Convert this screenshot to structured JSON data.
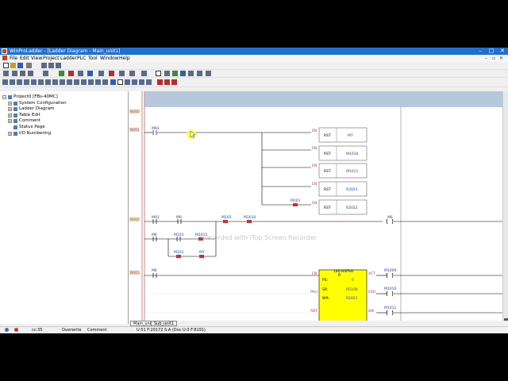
{
  "window": {
    "title": "WinProLadder - [Ladder Diagram - Main_unit1]"
  },
  "menu": [
    "File",
    "Edit",
    "View",
    "Project",
    "Ladder",
    "PLC",
    "Tool",
    "Window",
    "Help"
  ],
  "tree": [
    {
      "label": "Project0 [FBs-40MC]",
      "depth": 0,
      "expander": "−"
    },
    {
      "label": "System Configuration",
      "depth": 1,
      "expander": "+"
    },
    {
      "label": "Ladder Diagram",
      "depth": 1,
      "expander": "+"
    },
    {
      "label": "Table Edit",
      "depth": 1,
      "expander": "+"
    },
    {
      "label": "Comment",
      "depth": 1,
      "expander": "+"
    },
    {
      "label": "Status Page",
      "depth": 1,
      "expander": ""
    },
    {
      "label": "I/O Numbering",
      "depth": 1,
      "expander": "+"
    }
  ],
  "ladder": {
    "rungs": [
      "N000",
      "N001",
      "N002",
      "N003"
    ],
    "contacts": {
      "m93_r1": "M93",
      "m101_r1": "M101",
      "m93_r2": "M93",
      "m9_r2": "M9",
      "m105": "M105",
      "m1010": "M1010",
      "m6_r2": "M6",
      "m101_r2a": "M101",
      "m1011": "M1011",
      "m101_r2b": "M101",
      "m7_r2": "M7",
      "m6_r3": "M6",
      "en": "EN",
      "pau": "PAU",
      "abt": "ABT"
    },
    "reset_blocks": [
      {
        "op": "RST",
        "arg": "M7"
      },
      {
        "op": "RST",
        "arg": "M1010"
      },
      {
        "op": "RST",
        "arg": "M1011"
      },
      {
        "op": "RST",
        "arg": "R2021"
      },
      {
        "op": "RST",
        "arg": "R2022"
      }
    ],
    "en_label": "EN",
    "coil_m6": "M6",
    "fblock": {
      "title": "140.HSPSO",
      "sub": "R",
      "ps_label": "PS:",
      "ps_value": "0",
      "sr_label": "SR:",
      "sr_value": "R5100",
      "wr_label": "WR:",
      "wr_value": "R2021",
      "act": "ACT",
      "err": "ERR",
      "dn": "DN"
    },
    "outputs": [
      "M1009",
      "M1010",
      "M1011"
    ]
  },
  "tabs": [
    "Main_unit1",
    "Sub_unit1"
  ],
  "status": {
    "cursor": "cc:35",
    "mode": "Overwrite",
    "comment": "Comment",
    "info": "U:51 F:20172 S:A (Doc U:0 F:8191)"
  },
  "watermark": "Recorded with iTop Screen Recorder",
  "colors": {
    "titlebar": "#1e6fd0",
    "rail": "#e08080",
    "block_fill": "#ffff00",
    "contact_active": "#c83232",
    "wire": "#000000",
    "header_band": "#b8c8dc"
  }
}
